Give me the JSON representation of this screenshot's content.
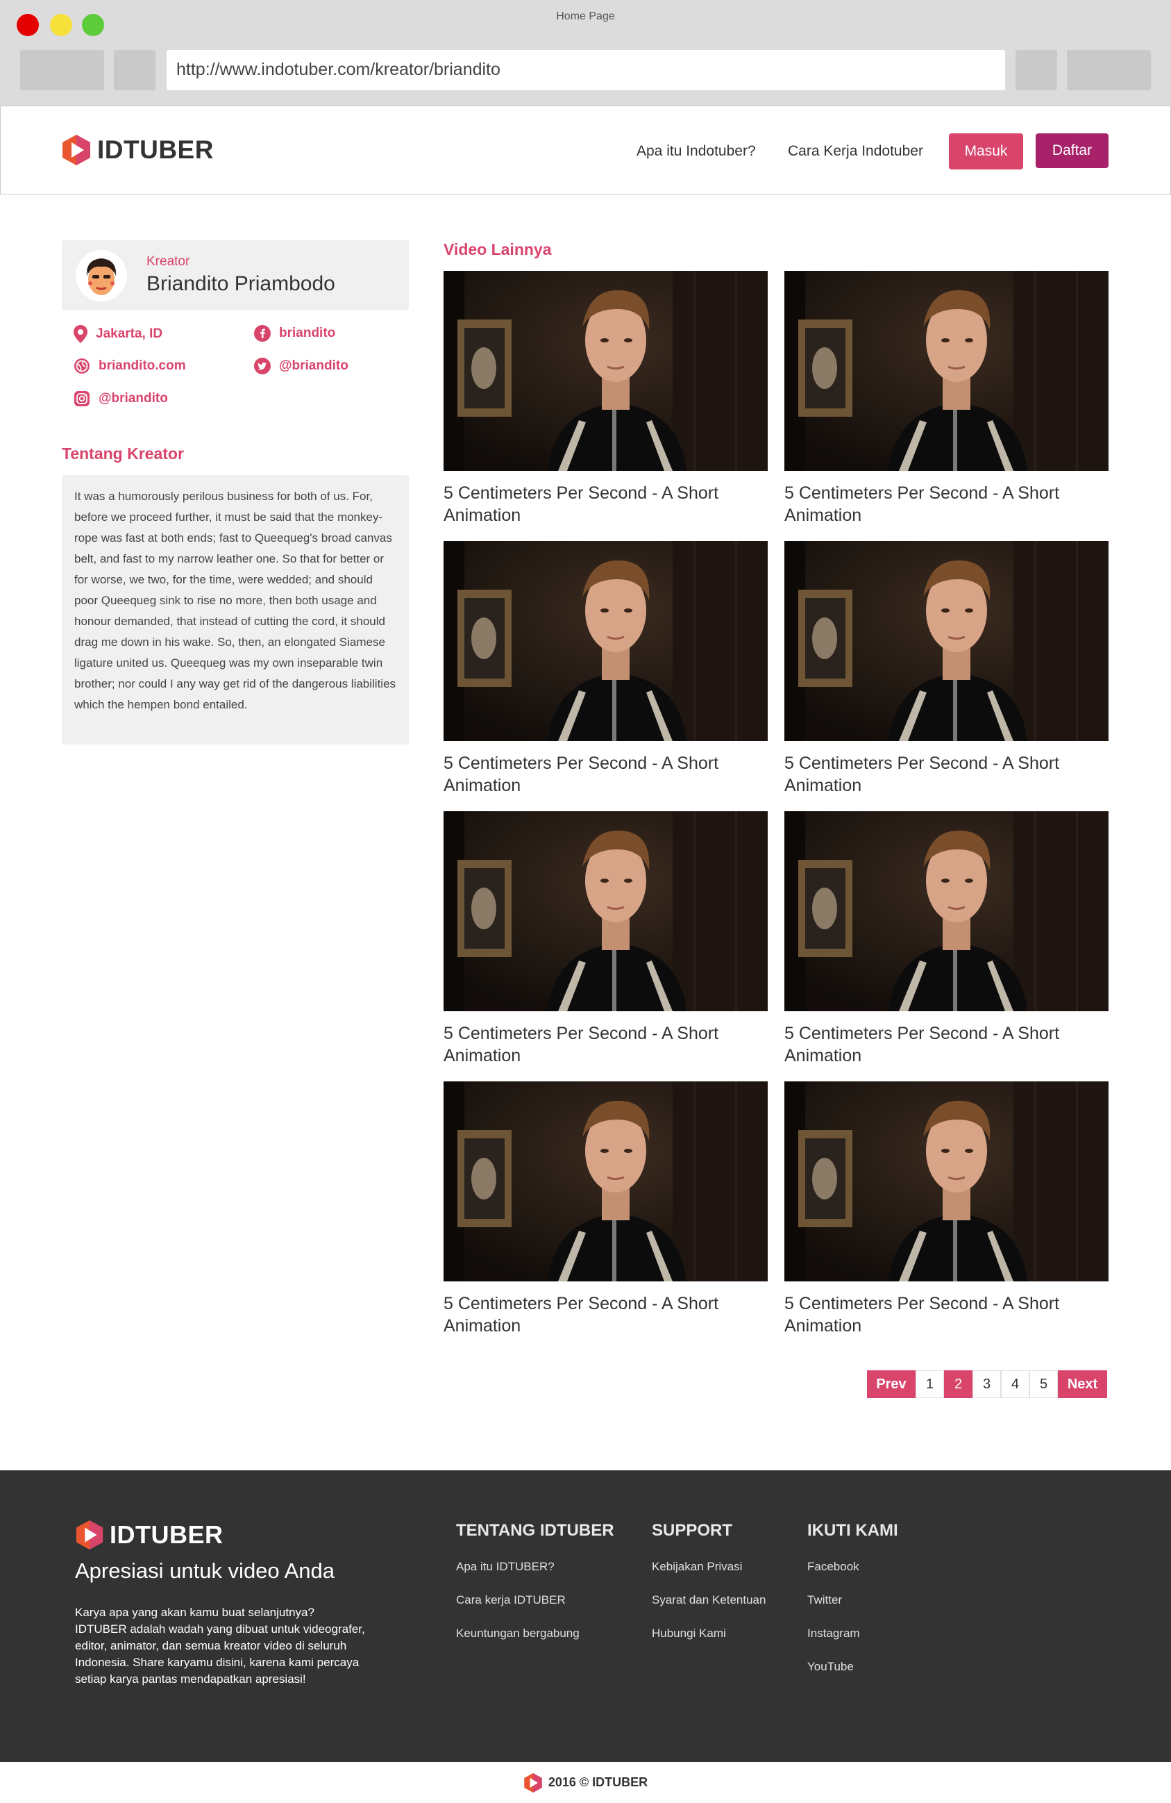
{
  "browser": {
    "title": "Home Page",
    "url": "http://www.indotuber.com/kreator/briandito"
  },
  "header": {
    "brand": "IDTUBER",
    "nav": [
      "Apa itu Indotuber?",
      "Cara Kerja Indotuber"
    ],
    "login_label": "Masuk",
    "register_label": "Daftar"
  },
  "profile": {
    "role": "Kreator",
    "name": "Briandito Priambodo",
    "location": "Jakarta, ID",
    "facebook": "briandito",
    "website": "briandito.com",
    "twitter": "@briandito",
    "instagram": "@briandito"
  },
  "about": {
    "title": "Tentang Kreator",
    "text": "It was a humorously perilous business for both of us. For, before we proceed further, it must be said that the monkey-rope was fast at both ends; fast to Queequeg's broad canvas belt, and fast to my narrow leather one. So that for better or for worse, we two, for the time, were wedded; and should poor Queequeg sink to rise no more, then both usage and honour demanded, that instead of cutting the cord, it should drag me down in his wake. So, then, an elongated Siamese ligature united us. Queequeg was my own inseparable twin brother; nor could I any way get rid of the dangerous liabilities which the hempen bond entailed."
  },
  "videos": {
    "title": "Video Lainnya",
    "items": [
      {
        "title": "5 Centimeters Per Second - A Short Animation"
      },
      {
        "title": "5 Centimeters Per Second - A Short Animation"
      },
      {
        "title": "5 Centimeters Per Second - A Short Animation"
      },
      {
        "title": "5 Centimeters Per Second - A Short Animation"
      },
      {
        "title": "5 Centimeters Per Second - A Short Animation"
      },
      {
        "title": "5 Centimeters Per Second - A Short Animation"
      },
      {
        "title": "5 Centimeters Per Second - A Short Animation"
      },
      {
        "title": "5 Centimeters Per Second - A Short Animation"
      }
    ]
  },
  "pagination": {
    "prev": "Prev",
    "next": "Next",
    "pages": [
      "1",
      "2",
      "3",
      "4",
      "5"
    ],
    "current": "2"
  },
  "footer": {
    "brand": "IDTUBER",
    "tagline": "Apresiasi untuk video Anda",
    "description": "Karya apa yang akan kamu buat selanjutnya? IDTUBER adalah wadah yang dibuat untuk videografer, editor, animator, dan semua kreator video di seluruh Indonesia.  Share karyamu disini, karena kami percaya setiap karya pantas mendapatkan apresiasi!",
    "columns": [
      {
        "title": "TENTANG IDTUBER",
        "links": [
          "Apa itu IDTUBER?",
          "Cara kerja IDTUBER",
          "Keuntungan bergabung"
        ]
      },
      {
        "title": "SUPPORT",
        "links": [
          "Kebijakan Privasi",
          "Syarat dan Ketentuan",
          "Hubungi Kami"
        ]
      },
      {
        "title": "IKUTI KAMI",
        "links": [
          "Facebook",
          "Twitter",
          "Instagram",
          "YouTube"
        ]
      }
    ],
    "copyright": "2016 © IDTUBER"
  },
  "colors": {
    "accent": "#d9446b",
    "accent_dark": "#a8226a",
    "footer_bg": "#333333"
  }
}
